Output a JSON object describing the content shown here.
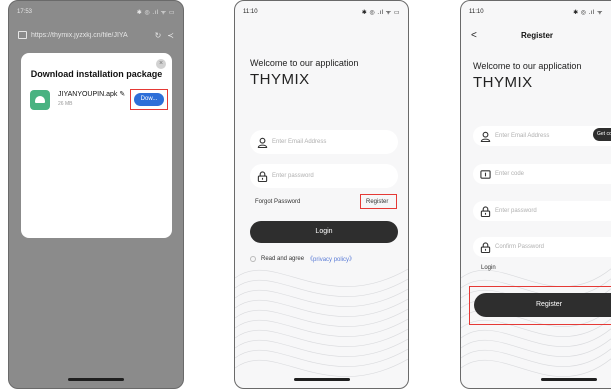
{
  "screen1": {
    "time": "17:53",
    "status_icons": "✱ ◎ .ıl ᯤ ▭",
    "url": "https://thymix.jyzxkj.cn/file/JIYA",
    "dialog": {
      "title": "Download installation package",
      "file_name": "JIYANYOUPIN.apk",
      "file_size": "26 MB",
      "download_label": "Dow..."
    }
  },
  "screen2": {
    "time": "11:10",
    "status_icons": "✱ ◎ .ıl ᯤ ▭",
    "welcome": "Welcome to our application",
    "brand": "THYMIX",
    "email_placeholder": "Enter Email Address",
    "password_placeholder": "Enter password",
    "forgot_label": "Forgot Password",
    "register_label": "Register",
    "login_label": "Login",
    "agree_label": "Read and agree",
    "policy_label": "《privacy policy》"
  },
  "screen3": {
    "time": "11:10",
    "status_icons": "✱ ◎ .ıl ᯤ",
    "back": "<",
    "title": "Register",
    "welcome": "Welcome to our application",
    "brand": "THYMIX",
    "email_placeholder": "Enter Email Address",
    "get_code_label": "Get code",
    "code_placeholder": "Enter code",
    "password_placeholder": "Enter password",
    "confirm_placeholder": "Confirm Password",
    "login_link": "Login",
    "register_button": "Register"
  },
  "colors": {
    "highlight": "#e53935",
    "download_button": "#2e6fd8",
    "dark_button": "#2e2e2e",
    "policy_link": "#5b7cd6",
    "apk_icon": "#48b281"
  }
}
